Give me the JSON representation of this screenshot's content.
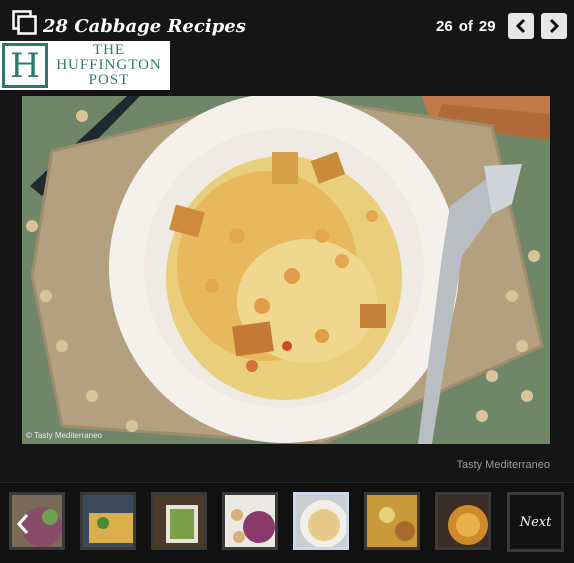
{
  "gallery": {
    "title": "28 Cabbage Recipes",
    "current": "26",
    "of_label": "of",
    "total": "29"
  },
  "logo": {
    "letter": "H",
    "line1": "THE",
    "line2": "HUFFINGTON",
    "line3": "POST"
  },
  "photo": {
    "overlay_credit": "© Tasty Mediterraneo",
    "credit": "Tasty Mediterraneo"
  },
  "thumbnails": {
    "next_label": "Next",
    "active_index": 4,
    "colors": {
      "active_border": "#c9d7e8",
      "border": "#3a3a3a"
    }
  },
  "icons": {
    "prev": "chevron-left-icon",
    "next": "chevron-right-icon",
    "gallery": "gallery-stack-icon"
  }
}
